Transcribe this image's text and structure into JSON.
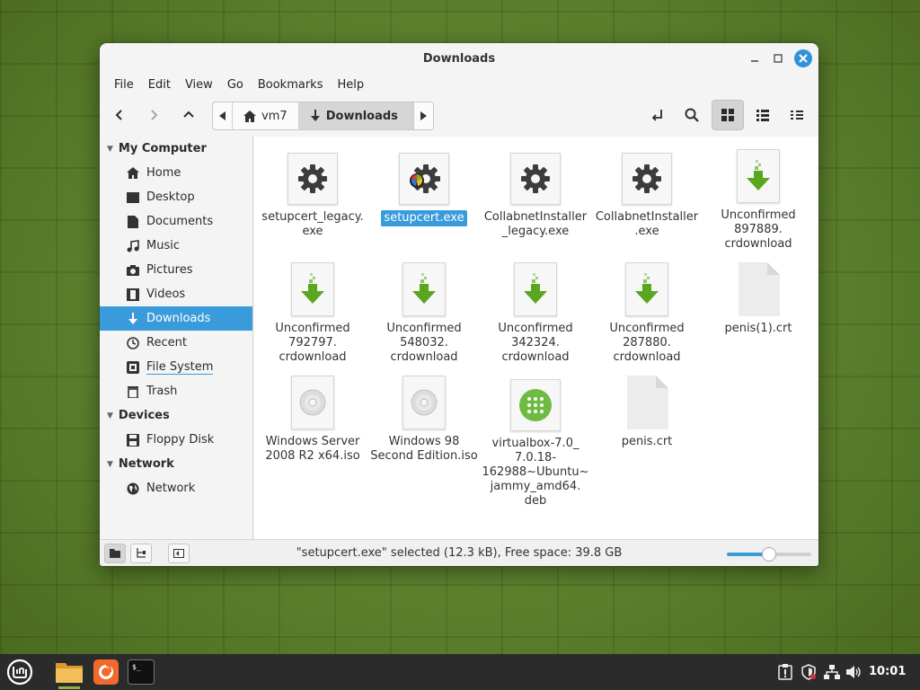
{
  "window": {
    "title": "Downloads",
    "controls": {
      "minimize": "–",
      "maximize": "□",
      "close": "×"
    }
  },
  "menubar": [
    "File",
    "Edit",
    "View",
    "Go",
    "Bookmarks",
    "Help"
  ],
  "toolbar": {
    "back_icon": "back-arrow-icon",
    "forward_icon": "forward-arrow-icon",
    "up_icon": "up-arrow-icon",
    "path": [
      {
        "label": "vm7",
        "icon": "home-icon"
      },
      {
        "label": "Downloads",
        "icon": "download-arrow-icon",
        "current": true
      }
    ],
    "right_icons": [
      "toggle-location-icon",
      "search-icon",
      "icon-view-icon",
      "list-view-icon",
      "compact-view-icon"
    ]
  },
  "sidebar": {
    "sections": [
      {
        "title": "My Computer",
        "items": [
          {
            "label": "Home",
            "icon": "home-icon"
          },
          {
            "label": "Desktop",
            "icon": "desktop-icon"
          },
          {
            "label": "Documents",
            "icon": "documents-icon"
          },
          {
            "label": "Music",
            "icon": "music-icon"
          },
          {
            "label": "Pictures",
            "icon": "camera-icon"
          },
          {
            "label": "Videos",
            "icon": "film-icon"
          },
          {
            "label": "Downloads",
            "icon": "download-arrow-icon",
            "active": true
          },
          {
            "label": "Recent",
            "icon": "clock-icon"
          },
          {
            "label": "File System",
            "icon": "drive-icon",
            "underlined": true
          },
          {
            "label": "Trash",
            "icon": "trash-icon"
          }
        ]
      },
      {
        "title": "Devices",
        "items": [
          {
            "label": "Floppy Disk",
            "icon": "floppy-icon"
          }
        ]
      },
      {
        "title": "Network",
        "items": [
          {
            "label": "Network",
            "icon": "globe-icon"
          }
        ]
      }
    ]
  },
  "files": [
    {
      "name": "setupcert_legacy.\nexe",
      "type": "exe"
    },
    {
      "name": "setupcert.exe",
      "type": "exe-wine",
      "selected": true
    },
    {
      "name": "CollabnetInstaller\n_legacy.exe",
      "type": "exe"
    },
    {
      "name": "CollabnetInstaller\n.exe",
      "type": "exe"
    },
    {
      "name": "Unconfirmed\n897889.\ncrdownload",
      "type": "download"
    },
    {
      "name": "Unconfirmed\n792797.\ncrdownload",
      "type": "download"
    },
    {
      "name": "Unconfirmed\n548032.\ncrdownload",
      "type": "download"
    },
    {
      "name": "Unconfirmed\n342324.\ncrdownload",
      "type": "download"
    },
    {
      "name": "Unconfirmed\n287880.\ncrdownload",
      "type": "download"
    },
    {
      "name": "penis(1).crt",
      "type": "blank"
    },
    {
      "name": "Windows Server\n2008 R2 x64.iso",
      "type": "iso"
    },
    {
      "name": "Windows 98\nSecond Edition.iso",
      "type": "iso"
    },
    {
      "name": "virtualbox-7.0_\n7.0.18-\n162988~Ubuntu~\njammy_amd64.\ndeb",
      "type": "deb"
    },
    {
      "name": "penis.crt",
      "type": "blank"
    }
  ],
  "statusbar": {
    "text": "\"setupcert.exe\" selected (12.3 kB), Free space: 39.8 GB",
    "zoom_level": 0.5
  },
  "taskbar": {
    "apps": [
      "mint-menu-icon",
      "files-icon",
      "firefox-icon",
      "terminal-icon"
    ],
    "tray": [
      "update-manager-icon",
      "security-shield-icon",
      "network-icon",
      "volume-icon"
    ],
    "clock": "10:01"
  },
  "colors": {
    "accent": "#3a9bdc",
    "download_green": "#5aa61e",
    "desktop_green": "#5f8530",
    "taskbar": "#2b2b2b"
  }
}
